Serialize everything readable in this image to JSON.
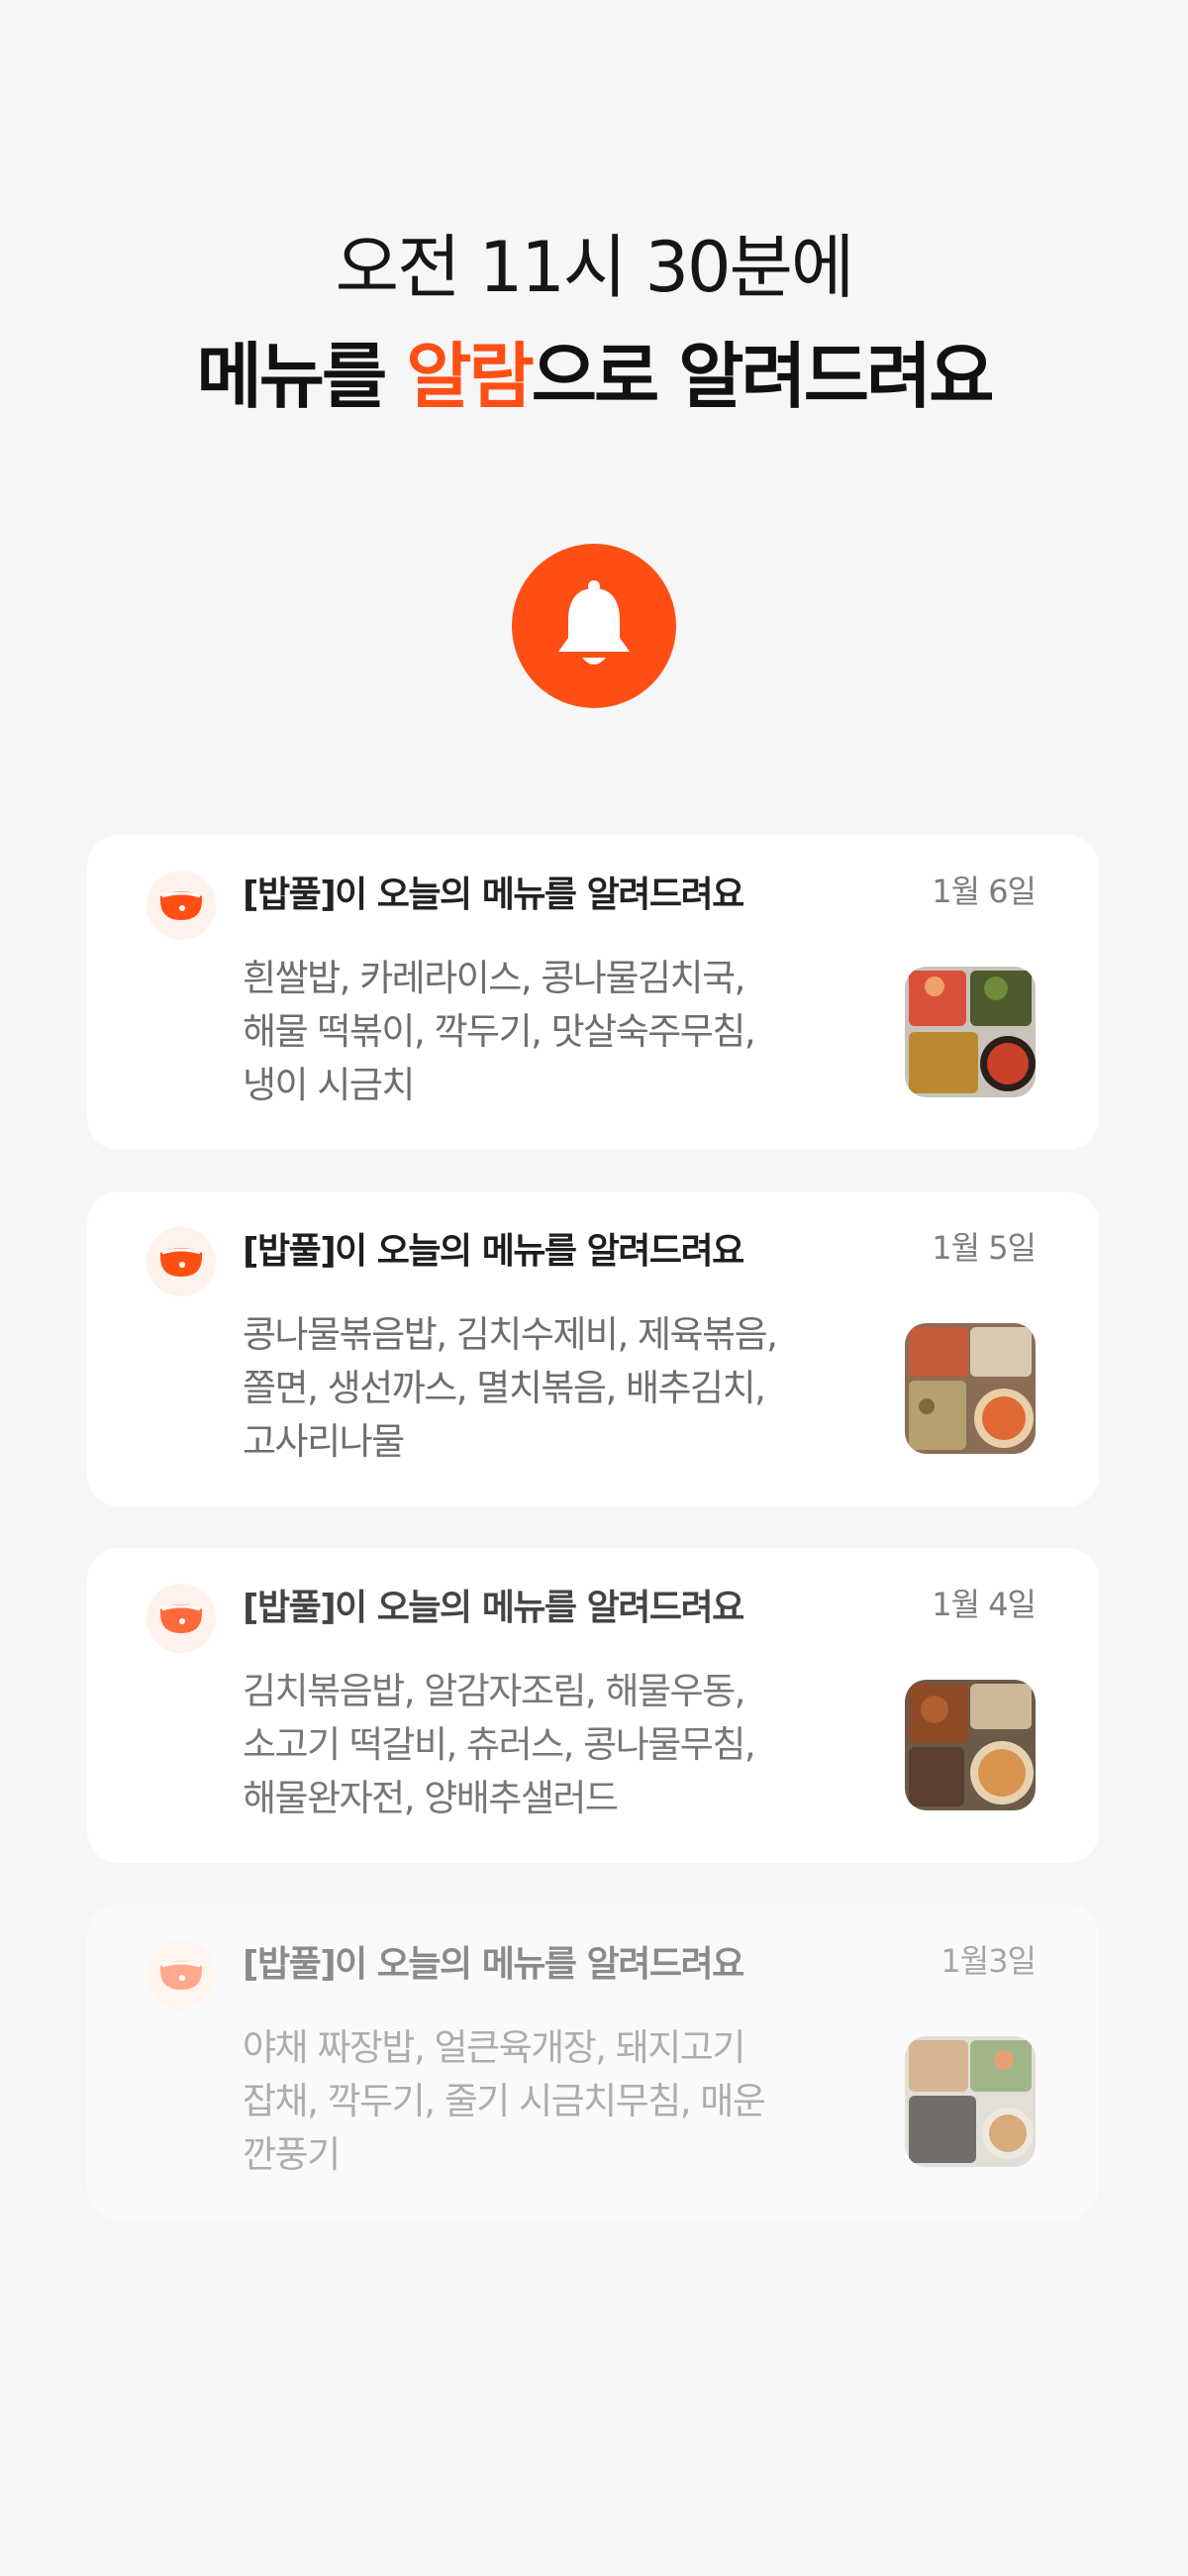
{
  "headline": {
    "line1": "오전 11시 30분에",
    "line2_part1": "메뉴를 ",
    "line2_accent": "알람",
    "line2_part2": "으로 알려드려요"
  },
  "colors": {
    "accent": "#ff4f15",
    "background": "#f6f6f6",
    "card": "#ffffff"
  },
  "bell_icon": "bell-icon",
  "notifications": [
    {
      "title": "[밥풀]이 오늘의 메뉴를 알려드려요",
      "date": "1월 6일",
      "menu": "흰쌀밥, 카레라이스, 콩나물김치국,\n해물 떡볶이, 깍두기, 맛살숙주무침,\n냉이 시금치"
    },
    {
      "title": "[밥풀]이 오늘의 메뉴를 알려드려요",
      "date": "1월 5일",
      "menu": "콩나물볶음밥, 김치수제비, 제육볶음,\n쫄면, 생선까스, 멸치볶음, 배추김치,\n고사리나물"
    },
    {
      "title": "[밥풀]이 오늘의 메뉴를 알려드려요",
      "date": "1월 4일",
      "menu": "김치볶음밥, 알감자조림, 해물우동,\n소고기 떡갈비, 츄러스, 콩나물무침,\n해물완자전, 양배추샐러드"
    },
    {
      "title": "[밥풀]이 오늘의 메뉴를 알려드려요",
      "date": "1월3일",
      "menu": "야채 짜장밥, 얼큰육개장, 돼지고기\n잡채, 깍두기, 줄기 시금치무침, 매운\n깐풍기"
    }
  ]
}
